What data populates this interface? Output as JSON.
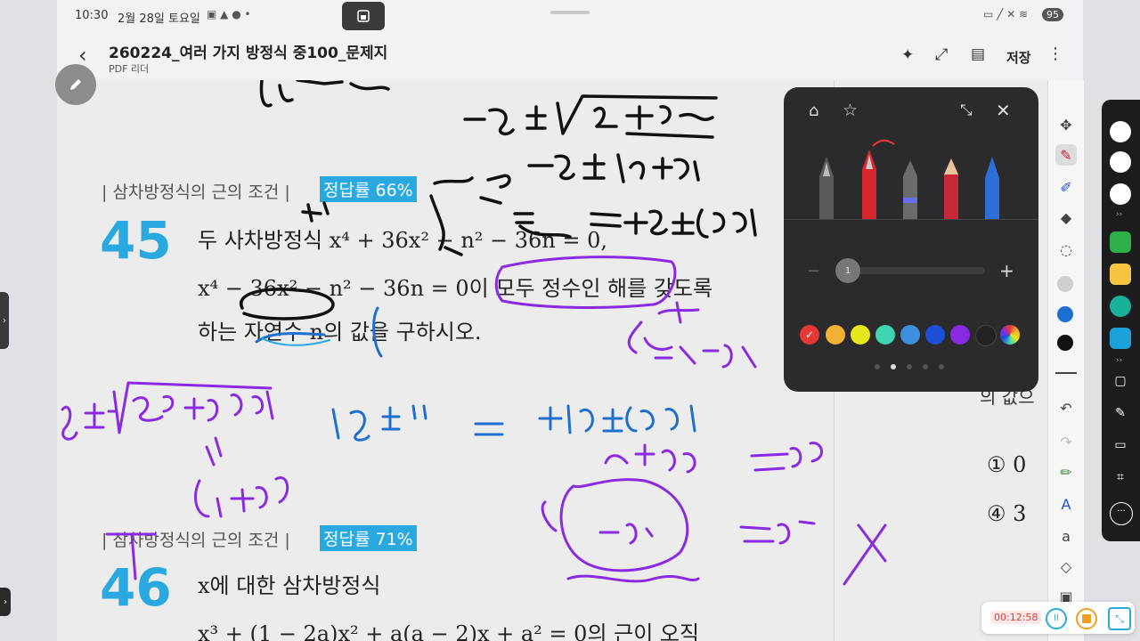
{
  "status_bar": {
    "time": "10:30",
    "date": "2월 28일 토요일",
    "battery": "95"
  },
  "header": {
    "title": "260224_여러 가지 방정식 중100_문제지",
    "subtitle": "PDF 리더",
    "save_label": "저장"
  },
  "problems": [
    {
      "tag": "| 삼차방정식의 근의 조건 |",
      "rate": "정답률 66%",
      "number": "45",
      "lines": [
        "두 사차방정식 x⁴ + 36x² − n² − 36n = 0,",
        "x⁴ − 36x² − n² − 36n = 0이 모두 정수인 해를 갖도록",
        "하는 자연수 n의 값을 구하시오."
      ]
    },
    {
      "tag": "| 삼차방정식의 근의 조건 |",
      "rate": "정답률 71%",
      "number": "46",
      "lines": [
        "x에 대한 삼차방정식",
        "x³ + (1 − 2a)x² + a(a − 2)x + a² = 0의 근이 오직"
      ]
    }
  ],
  "right_page": {
    "text_partial": "의 값으",
    "choices": [
      "① 0",
      "④ 3"
    ]
  },
  "pen_panel": {
    "thickness": "1",
    "pens": [
      "fountain-pen-gray",
      "fountain-pen-red",
      "pen-blue-band",
      "pencil-red",
      "brush-blue"
    ],
    "colors": [
      "#e53935",
      "#f2b233",
      "#e6e61c",
      "#3dd6b0",
      "#3f8fe0",
      "#1e4fd8",
      "#8a2be2",
      "#222222",
      "rainbow"
    ]
  },
  "timer": {
    "elapsed": "00:12:58"
  },
  "accent": {
    "badge": "#29a9e0",
    "ink_purple": "#8a2be2",
    "ink_blue": "#1e6fd0"
  }
}
